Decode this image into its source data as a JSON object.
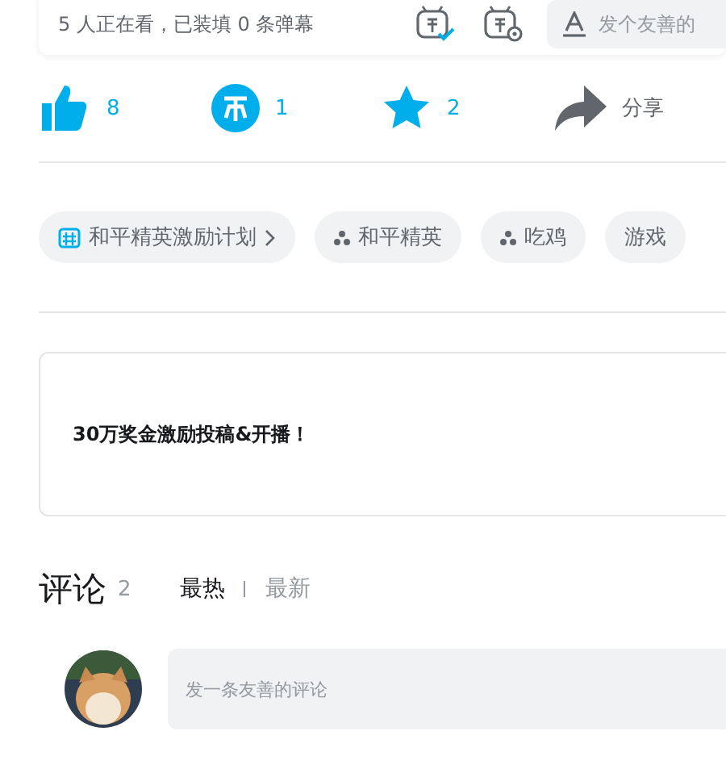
{
  "danmaku_bar": {
    "status": "5 人正在看，已装填 0 条弹幕",
    "placeholder": "发个友善的"
  },
  "actions": [
    {
      "kind": "like",
      "count": "8"
    },
    {
      "kind": "coin",
      "count": "1"
    },
    {
      "kind": "favorite",
      "count": "2"
    },
    {
      "kind": "share",
      "count": "分享"
    }
  ],
  "tags": [
    {
      "kind": "topic",
      "label": "和平精英激励计划"
    },
    {
      "kind": "channel",
      "label": "和平精英"
    },
    {
      "kind": "channel",
      "label": "吃鸡"
    },
    {
      "kind": "plain",
      "label": "游戏"
    }
  ],
  "notice": {
    "text": "30万奖金激励投稿&开播！"
  },
  "comments": {
    "title": "评论",
    "count": "2",
    "sort_tabs": [
      {
        "label": "最热",
        "selected": true
      },
      {
        "label": "最新",
        "selected": false
      }
    ],
    "placeholder": "发一条友善的评论"
  }
}
